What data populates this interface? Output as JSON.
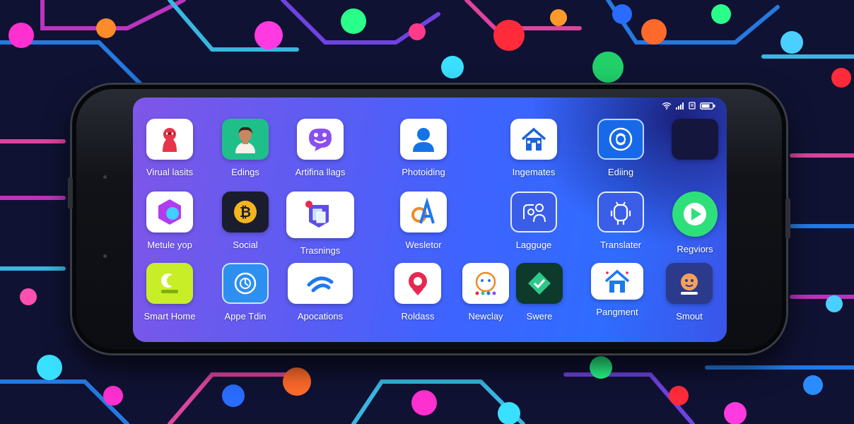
{
  "status_bar": {
    "icons": [
      "wifi-icon",
      "signal-icon",
      "sim-icon",
      "battery-icon"
    ]
  },
  "apps": [
    {
      "label": "Virual lasits",
      "icon": "mask-person-icon",
      "tint": "#ffffff",
      "accent": "#e8344a"
    },
    {
      "label": "Edings",
      "icon": "avatar-person-icon",
      "tint": "#1fbf8a",
      "accent": "#f0b38a"
    },
    {
      "label": "Artifina llags",
      "icon": "smiley-chat-icon",
      "tint": "#ffffff",
      "accent": "#8a4ff0"
    },
    {
      "label": "Photoiding",
      "icon": "user-icon",
      "tint": "#ffffff",
      "accent": "#1573e8"
    },
    {
      "label": "Ingemates",
      "icon": "house-icon",
      "tint": "#ffffff",
      "accent": "#1e64d8"
    },
    {
      "label": "Ediing",
      "icon": "rose-badge-icon",
      "tint": "#1769e8",
      "accent": "#ffffff"
    },
    {
      "label": "",
      "icon": "blank-app-icon",
      "tint": "#15163d",
      "accent": "#15163d"
    },
    {
      "label": "Metule yop",
      "icon": "hexagon-icon",
      "tint": "#ffffff",
      "accent": "#b13cf0"
    },
    {
      "label": "Social",
      "icon": "bitcoin-icon",
      "tint": "#1a1d2e",
      "accent": "#f5b51e"
    },
    {
      "label": "Trasnings",
      "icon": "documents-icon",
      "tint": "#ffffff",
      "accent": "#5a4fe0"
    },
    {
      "label": "Wesletor",
      "icon": "letter-a-icon",
      "tint": "#ffffff",
      "accent": "#1e78f0"
    },
    {
      "label": "Lagguge",
      "icon": "language-people-icon",
      "tint": "#3a5ee8",
      "accent": "#ffffff"
    },
    {
      "label": "Translater",
      "icon": "robot-icon",
      "tint": "#3a5ee8",
      "accent": "#ffffff"
    },
    {
      "label": "Regviors",
      "icon": "play-chat-icon",
      "tint": "#2ee07a",
      "accent": "#ffffff"
    },
    {
      "label": "Smart Home",
      "icon": "smart-home-icon",
      "tint": "#c8ee28",
      "accent": "#ffffff"
    },
    {
      "label": "Appe Tdin",
      "icon": "compass-icon",
      "tint": "#2d8ff0",
      "accent": "#ffffff"
    },
    {
      "label": "Apocations",
      "icon": "wifi-waves-icon",
      "tint": "#ffffff",
      "accent": "#1e78f0"
    },
    {
      "label": "Roldass",
      "icon": "pin-icon",
      "tint": "#ffffff",
      "accent": "#e82850"
    },
    {
      "label": "Newclay",
      "icon": "face-dots-icon",
      "tint": "#ffffff",
      "accent": "#f08a28"
    },
    {
      "label": "Swere",
      "icon": "check-diamond-icon",
      "tint": "#0d3a2a",
      "accent": "#2ec88a"
    },
    {
      "label": "Pangment",
      "icon": "home-roof-icon",
      "tint": "#ffffff",
      "accent": "#1e78f0"
    },
    {
      "label": "Smout",
      "icon": "person-face-icon",
      "tint": "#2b3a8a",
      "accent": "#f5a05a"
    }
  ]
}
